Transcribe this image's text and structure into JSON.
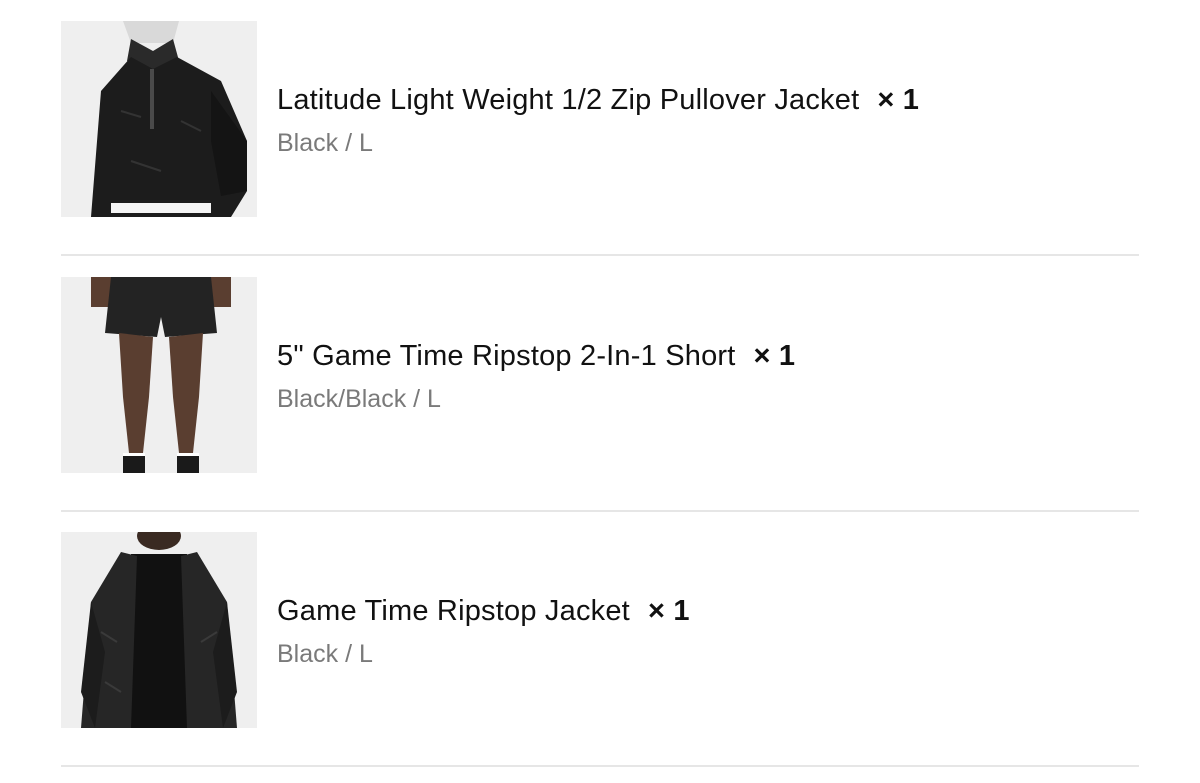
{
  "order_items": [
    {
      "name": "Latitude Light Weight 1/2 Zip Pullover Jacket",
      "quantity": "× 1",
      "variant": "Black / L",
      "image_icon": "jacket-photo"
    },
    {
      "name": "5\" Game Time Ripstop 2-In-1 Short",
      "quantity": "× 1",
      "variant": "Black/Black / L",
      "image_icon": "shorts-photo"
    },
    {
      "name": "Game Time Ripstop Jacket",
      "quantity": "× 1",
      "variant": "Black / L",
      "image_icon": "jacket-photo"
    }
  ],
  "colors": {
    "title": "#111111",
    "variant": "#7a7a7a",
    "divider": "#e6e6e6",
    "thumb_bg": "#eeeeee"
  }
}
